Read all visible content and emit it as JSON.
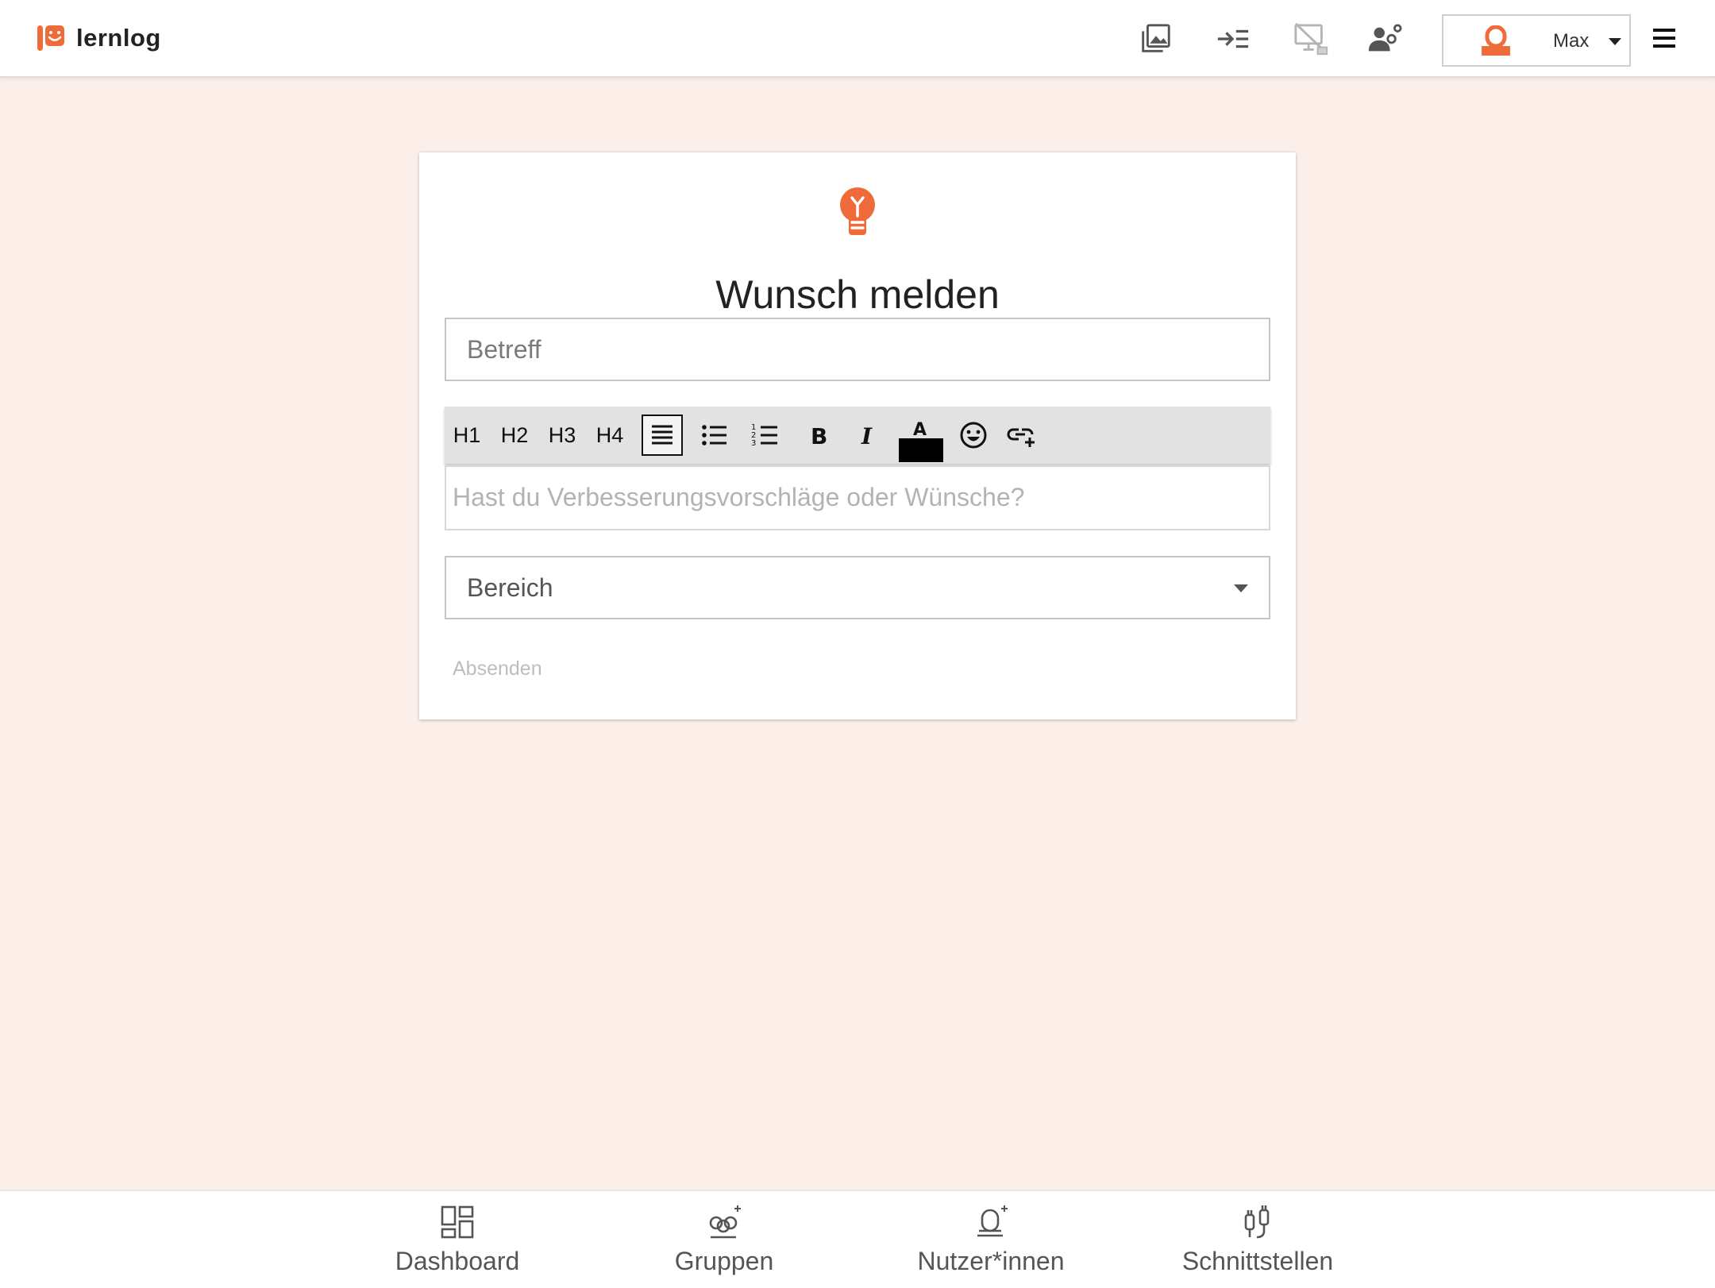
{
  "brand": {
    "name": "lernlog",
    "logo_icon": "lernlog-logo-icon",
    "accent": "#ef6c3a"
  },
  "header": {
    "icons": [
      "gallery-icon",
      "indent-icon",
      "desktop-off-icon",
      "user-settings-icon"
    ],
    "user": {
      "name": "Max",
      "avatar_icon": "teacher-avatar-icon"
    },
    "menu_icon": "hamburger-menu-icon"
  },
  "form": {
    "icon": "lightbulb-icon",
    "title": "Wunsch melden",
    "subject_placeholder": "Betreff",
    "toolbar": {
      "headings": [
        "H1",
        "H2",
        "H3",
        "H4"
      ],
      "buttons": [
        "paragraph-icon",
        "bulleted-list-icon",
        "numbered-list-icon",
        "bold-icon",
        "italic-icon",
        "text-color-icon",
        "emoji-icon",
        "insert-link-icon"
      ],
      "text_color": "#000000"
    },
    "editor_placeholder": "Hast du Verbesserungsvorschläge oder Wünsche?",
    "area_select": "Bereich",
    "submit_label": "Absenden"
  },
  "bottom_nav": [
    {
      "label": "Dashboard",
      "icon": "dashboard-icon"
    },
    {
      "label": "Gruppen",
      "icon": "groups-icon"
    },
    {
      "label": "Nutzer*innen",
      "icon": "users-icon"
    },
    {
      "label": "Schnittstellen",
      "icon": "interfaces-icon"
    }
  ]
}
